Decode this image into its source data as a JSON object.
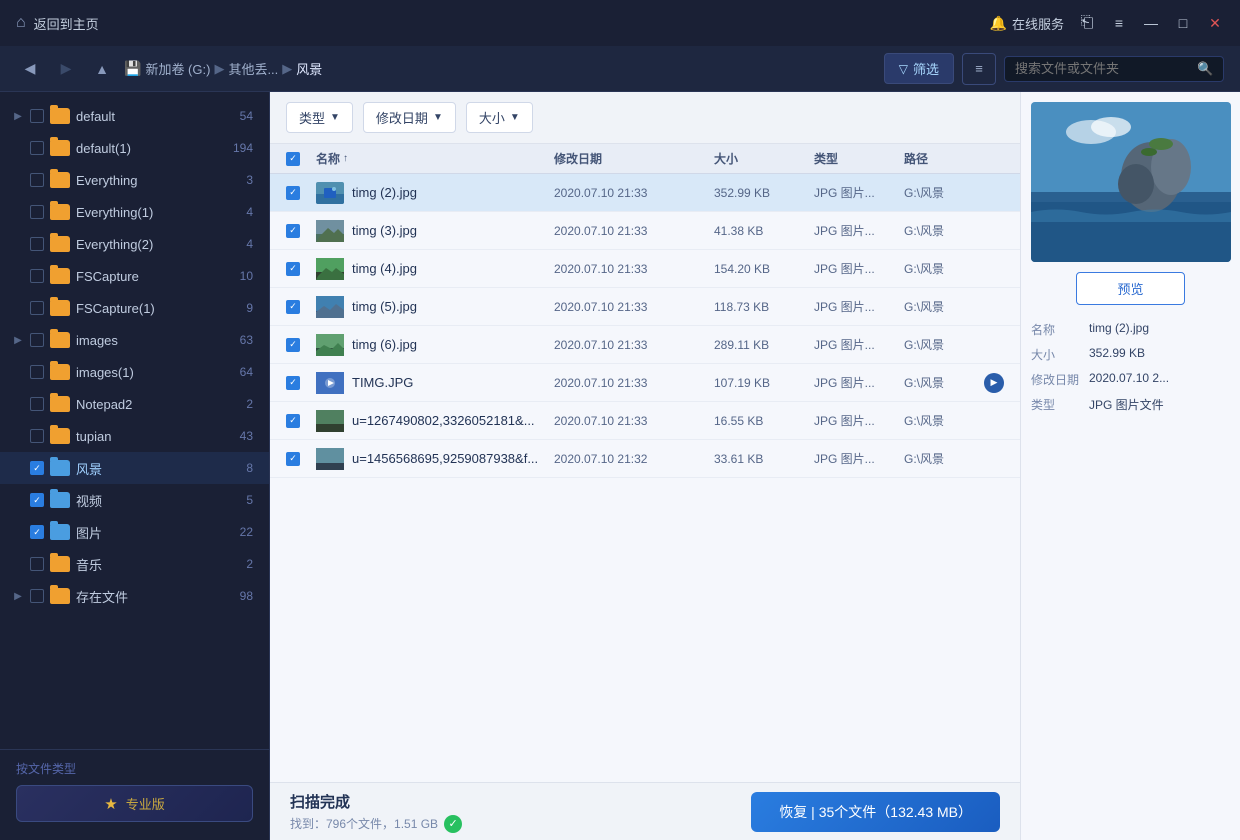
{
  "titleBar": {
    "homeLabel": "返回到主页",
    "onlineService": "在线服务",
    "menuIcon": "≡",
    "minimizeIcon": "—",
    "maximizeIcon": "□",
    "closeIcon": "✕"
  },
  "navBar": {
    "breadcrumb": [
      "新加卷 (G:)",
      "其他丢...",
      "风景"
    ],
    "filterLabel": "筛选",
    "searchPlaceholder": "搜索文件或文件夹"
  },
  "filterBar": {
    "chips": [
      "类型",
      "修改日期",
      "大小"
    ]
  },
  "tableHeader": {
    "name": "名称",
    "date": "修改日期",
    "size": "大小",
    "type": "类型",
    "path": "路径"
  },
  "files": [
    {
      "name": "timg (2).jpg",
      "date": "2020.07.10 21:33",
      "size": "352.99 KB",
      "type": "JPG 图片...",
      "path": "G:\\风景",
      "selected": true,
      "checked": true
    },
    {
      "name": "timg (3).jpg",
      "date": "2020.07.10 21:33",
      "size": "41.38 KB",
      "type": "JPG 图片...",
      "path": "G:\\风景",
      "selected": false,
      "checked": true
    },
    {
      "name": "timg (4).jpg",
      "date": "2020.07.10 21:33",
      "size": "154.20 KB",
      "type": "JPG 图片...",
      "path": "G:\\风景",
      "selected": false,
      "checked": true
    },
    {
      "name": "timg (5).jpg",
      "date": "2020.07.10 21:33",
      "size": "118.73 KB",
      "type": "JPG 图片...",
      "path": "G:\\风景",
      "selected": false,
      "checked": true
    },
    {
      "name": "timg (6).jpg",
      "date": "2020.07.10 21:33",
      "size": "289.11 KB",
      "type": "JPG 图片...",
      "path": "G:\\风景",
      "selected": false,
      "checked": true
    },
    {
      "name": "TIMG.JPG",
      "date": "2020.07.10 21:33",
      "size": "107.19 KB",
      "type": "JPG 图片...",
      "path": "G:\\风景",
      "selected": false,
      "checked": true,
      "hasPlay": true
    },
    {
      "name": "u=1267490802,3326052181&...",
      "date": "2020.07.10 21:33",
      "size": "16.55 KB",
      "type": "JPG 图片...",
      "path": "G:\\风景",
      "selected": false,
      "checked": true
    },
    {
      "name": "u=1456568695,9259087938&f...",
      "date": "2020.07.10 21:32",
      "size": "33.61 KB",
      "type": "JPG 图片...",
      "path": "G:\\风景",
      "selected": false,
      "checked": true
    }
  ],
  "sidebar": {
    "items": [
      {
        "label": "default",
        "count": "54",
        "hasExpand": true,
        "checked": false,
        "indent": false
      },
      {
        "label": "default(1)",
        "count": "194",
        "hasExpand": false,
        "checked": false,
        "indent": false
      },
      {
        "label": "Everything",
        "count": "3",
        "hasExpand": false,
        "checked": false,
        "indent": false
      },
      {
        "label": "Everything(1)",
        "count": "4",
        "hasExpand": false,
        "checked": false,
        "indent": false
      },
      {
        "label": "Everything(2)",
        "count": "4",
        "hasExpand": false,
        "checked": false,
        "indent": false
      },
      {
        "label": "FSCapture",
        "count": "10",
        "hasExpand": false,
        "checked": false,
        "indent": false
      },
      {
        "label": "FSCapture(1)",
        "count": "9",
        "hasExpand": false,
        "checked": false,
        "indent": false
      },
      {
        "label": "images",
        "count": "63",
        "hasExpand": true,
        "checked": false,
        "indent": false
      },
      {
        "label": "images(1)",
        "count": "64",
        "hasExpand": false,
        "checked": false,
        "indent": false
      },
      {
        "label": "Notepad2",
        "count": "2",
        "hasExpand": false,
        "checked": false,
        "indent": false
      },
      {
        "label": "tupian",
        "count": "43",
        "hasExpand": false,
        "checked": false,
        "indent": false
      },
      {
        "label": "风景",
        "count": "8",
        "hasExpand": false,
        "checked": true,
        "indent": false,
        "active": true
      },
      {
        "label": "视频",
        "count": "5",
        "hasExpand": false,
        "checked": true,
        "indent": false
      },
      {
        "label": "图片",
        "count": "22",
        "hasExpand": false,
        "checked": true,
        "indent": false
      },
      {
        "label": "音乐",
        "count": "2",
        "hasExpand": false,
        "checked": false,
        "indent": false
      },
      {
        "label": "存在文件",
        "count": "98",
        "hasExpand": true,
        "checked": false,
        "indent": false
      }
    ],
    "footerText": "按文件类型",
    "proLabel": "专业版"
  },
  "preview": {
    "buttonLabel": "预览",
    "infoLabels": {
      "name": "名称",
      "size": "大小",
      "date": "修改日期",
      "type": "类型"
    },
    "infoValues": {
      "name": "timg (2).jpg",
      "size": "352.99 KB",
      "date": "2020.07.10 2...",
      "type": "JPG 图片文件"
    }
  },
  "bottomBar": {
    "scanTitle": "扫描完成",
    "scanDetail": "找到：796个文件，1.51 GB",
    "recoverLabel": "恢复 | 35个文件（132.43 MB）"
  }
}
